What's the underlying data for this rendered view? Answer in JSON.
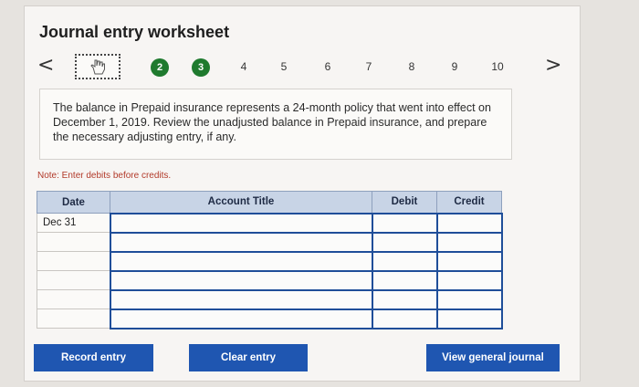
{
  "header": {
    "title": "Journal entry worksheet"
  },
  "stepper": {
    "prev": "<",
    "next": ">",
    "steps": [
      "2",
      "3",
      "4",
      "5",
      "6",
      "7",
      "8",
      "9",
      "10"
    ]
  },
  "info": {
    "text": "The balance in Prepaid insurance represents a 24-month policy that went into effect on December 1, 2019. Review the unadjusted balance in Prepaid insurance, and prepare the necessary adjusting entry, if any."
  },
  "note": "Note: Enter debits before credits.",
  "table": {
    "headers": [
      "Date",
      "Account Title",
      "Debit",
      "Credit"
    ],
    "rows": [
      [
        "Dec 31",
        "",
        "",
        ""
      ],
      [
        "",
        "",
        "",
        ""
      ],
      [
        "",
        "",
        "",
        ""
      ],
      [
        "",
        "",
        "",
        ""
      ],
      [
        "",
        "",
        "",
        ""
      ],
      [
        "",
        "",
        "",
        ""
      ]
    ]
  },
  "buttons": {
    "record": "Record entry",
    "clear": "Clear entry",
    "view": "View general journal"
  }
}
